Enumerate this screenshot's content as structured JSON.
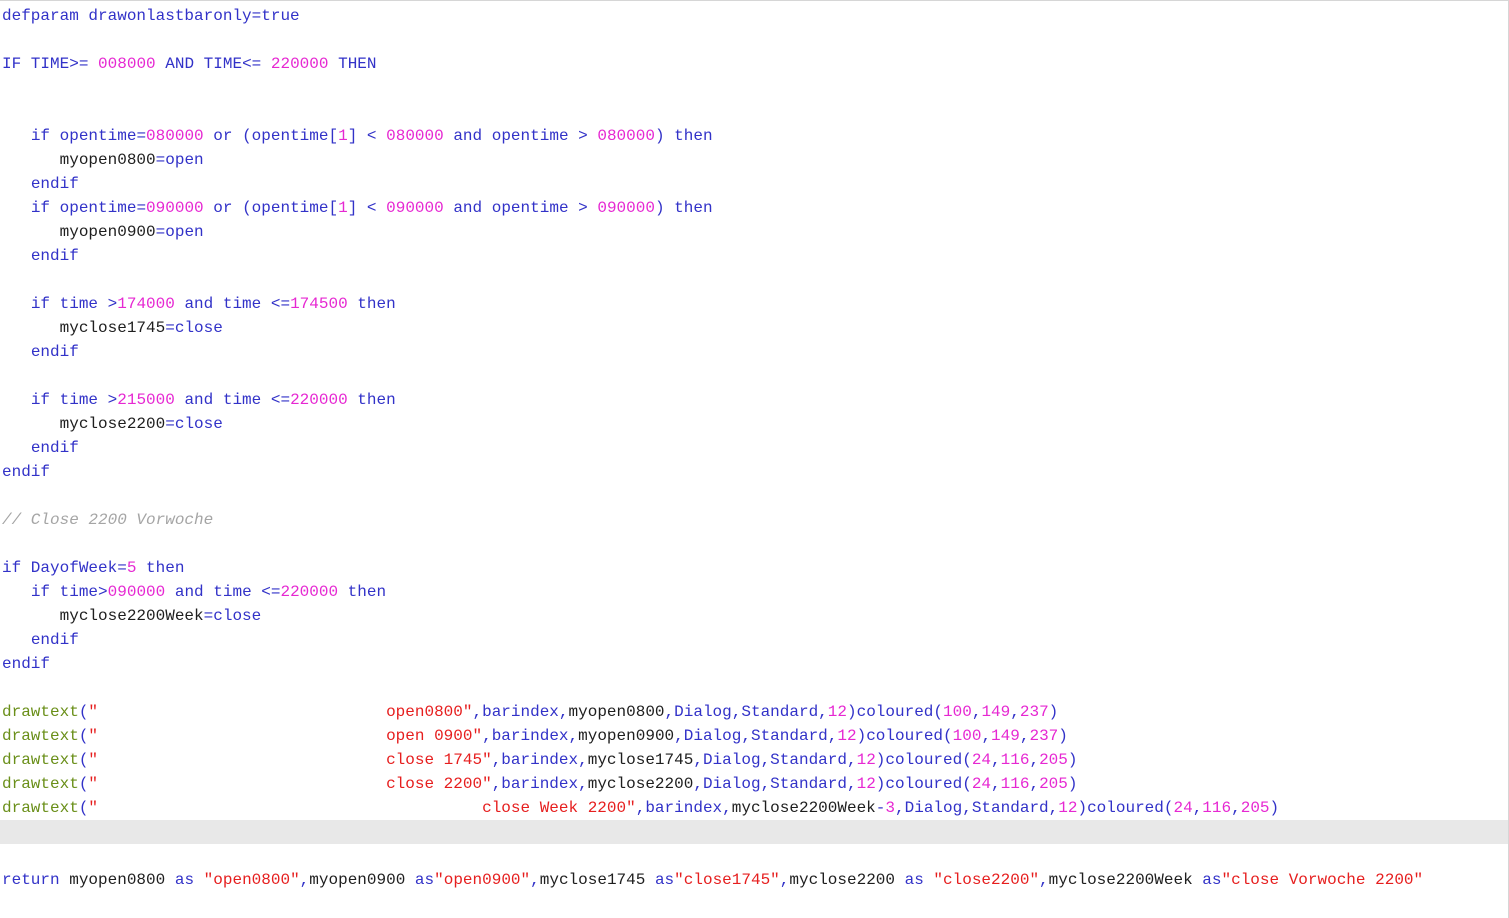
{
  "colors": {
    "keyword": "#3232c8",
    "number": "#e628d2",
    "string": "#e61e1e",
    "function": "#6a8f19",
    "comment": "#a5a5a5",
    "identifier": "#1e1e1e",
    "current_line": "#e8e8e8"
  },
  "editor": {
    "lines": [
      {
        "line": 1,
        "tokens": [
          [
            "kw",
            "defparam drawonlastbaronly"
          ],
          [
            "op",
            "="
          ],
          [
            "kw",
            "true"
          ]
        ]
      },
      {
        "line": 3,
        "tokens": [
          [
            "kw",
            "IF TIME"
          ],
          [
            "op",
            ">= "
          ],
          [
            "num",
            "008000"
          ],
          [
            "kw",
            " AND TIME"
          ],
          [
            "op",
            "<= "
          ],
          [
            "num",
            "220000"
          ],
          [
            "kw",
            " THEN"
          ]
        ]
      },
      {
        "line": 6,
        "tokens": [
          [
            "id",
            "   "
          ],
          [
            "kw",
            "if opentime"
          ],
          [
            "op",
            "="
          ],
          [
            "num",
            "080000"
          ],
          [
            "kw",
            " or "
          ],
          [
            "op",
            "("
          ],
          [
            "kw",
            "opentime"
          ],
          [
            "op",
            "["
          ],
          [
            "num",
            "1"
          ],
          [
            "op",
            "] < "
          ],
          [
            "num",
            "080000"
          ],
          [
            "kw",
            " and opentime "
          ],
          [
            "op",
            "> "
          ],
          [
            "num",
            "080000"
          ],
          [
            "op",
            ")"
          ],
          [
            "kw",
            " then"
          ]
        ]
      },
      {
        "line": 7,
        "tokens": [
          [
            "id",
            "      myopen0800"
          ],
          [
            "op",
            "="
          ],
          [
            "kw",
            "open"
          ]
        ]
      },
      {
        "line": 8,
        "tokens": [
          [
            "id",
            "   "
          ],
          [
            "kw",
            "endif"
          ]
        ]
      },
      {
        "line": 9,
        "tokens": [
          [
            "id",
            "   "
          ],
          [
            "kw",
            "if opentime"
          ],
          [
            "op",
            "="
          ],
          [
            "num",
            "090000"
          ],
          [
            "kw",
            " or "
          ],
          [
            "op",
            "("
          ],
          [
            "kw",
            "opentime"
          ],
          [
            "op",
            "["
          ],
          [
            "num",
            "1"
          ],
          [
            "op",
            "] < "
          ],
          [
            "num",
            "090000"
          ],
          [
            "kw",
            " and opentime "
          ],
          [
            "op",
            "> "
          ],
          [
            "num",
            "090000"
          ],
          [
            "op",
            ")"
          ],
          [
            "kw",
            " then"
          ]
        ]
      },
      {
        "line": 10,
        "tokens": [
          [
            "id",
            "      myopen0900"
          ],
          [
            "op",
            "="
          ],
          [
            "kw",
            "open"
          ]
        ]
      },
      {
        "line": 11,
        "tokens": [
          [
            "id",
            "   "
          ],
          [
            "kw",
            "endif"
          ]
        ]
      },
      {
        "line": 13,
        "tokens": [
          [
            "id",
            "   "
          ],
          [
            "kw",
            "if time "
          ],
          [
            "op",
            ">"
          ],
          [
            "num",
            "174000"
          ],
          [
            "kw",
            " and time "
          ],
          [
            "op",
            "<="
          ],
          [
            "num",
            "174500"
          ],
          [
            "kw",
            " then"
          ]
        ]
      },
      {
        "line": 14,
        "tokens": [
          [
            "id",
            "      myclose1745"
          ],
          [
            "op",
            "="
          ],
          [
            "kw",
            "close"
          ]
        ]
      },
      {
        "line": 15,
        "tokens": [
          [
            "id",
            "   "
          ],
          [
            "kw",
            "endif"
          ]
        ]
      },
      {
        "line": 17,
        "tokens": [
          [
            "id",
            "   "
          ],
          [
            "kw",
            "if time "
          ],
          [
            "op",
            ">"
          ],
          [
            "num",
            "215000"
          ],
          [
            "kw",
            " and time "
          ],
          [
            "op",
            "<="
          ],
          [
            "num",
            "220000"
          ],
          [
            "kw",
            " then"
          ]
        ]
      },
      {
        "line": 18,
        "tokens": [
          [
            "id",
            "      myclose2200"
          ],
          [
            "op",
            "="
          ],
          [
            "kw",
            "close"
          ]
        ]
      },
      {
        "line": 19,
        "tokens": [
          [
            "id",
            "   "
          ],
          [
            "kw",
            "endif"
          ]
        ]
      },
      {
        "line": 20,
        "tokens": [
          [
            "kw",
            "endif"
          ]
        ]
      },
      {
        "line": 22,
        "tokens": [
          [
            "cm",
            "// Close 2200 Vorwoche"
          ]
        ]
      },
      {
        "line": 24,
        "tokens": [
          [
            "kw",
            "if DayofWeek"
          ],
          [
            "op",
            "="
          ],
          [
            "num",
            "5"
          ],
          [
            "kw",
            " then"
          ]
        ]
      },
      {
        "line": 25,
        "tokens": [
          [
            "id",
            "   "
          ],
          [
            "kw",
            "if time"
          ],
          [
            "op",
            ">"
          ],
          [
            "num",
            "090000"
          ],
          [
            "kw",
            " and time "
          ],
          [
            "op",
            "<="
          ],
          [
            "num",
            "220000"
          ],
          [
            "kw",
            " then"
          ]
        ]
      },
      {
        "line": 26,
        "tokens": [
          [
            "id",
            "      myclose2200Week"
          ],
          [
            "op",
            "="
          ],
          [
            "kw",
            "close"
          ]
        ]
      },
      {
        "line": 27,
        "tokens": [
          [
            "id",
            "   "
          ],
          [
            "kw",
            "endif"
          ]
        ]
      },
      {
        "line": 28,
        "tokens": [
          [
            "kw",
            "endif"
          ]
        ]
      },
      {
        "line": 30,
        "tokens": [
          [
            "fn",
            "drawtext"
          ],
          [
            "op",
            "("
          ],
          [
            "str",
            "\"                              open0800\""
          ],
          [
            "op",
            ","
          ],
          [
            "kw",
            "barindex"
          ],
          [
            "op",
            ","
          ],
          [
            "id",
            "myopen0800"
          ],
          [
            "op",
            ","
          ],
          [
            "kw",
            "Dialog"
          ],
          [
            "op",
            ","
          ],
          [
            "kw",
            "Standard"
          ],
          [
            "op",
            ","
          ],
          [
            "num",
            "12"
          ],
          [
            "op",
            ")"
          ],
          [
            "kw",
            "coloured"
          ],
          [
            "op",
            "("
          ],
          [
            "num",
            "100"
          ],
          [
            "op",
            ","
          ],
          [
            "num",
            "149"
          ],
          [
            "op",
            ","
          ],
          [
            "num",
            "237"
          ],
          [
            "op",
            ")"
          ]
        ]
      },
      {
        "line": 31,
        "tokens": [
          [
            "fn",
            "drawtext"
          ],
          [
            "op",
            "("
          ],
          [
            "str",
            "\"                              open 0900\""
          ],
          [
            "op",
            ","
          ],
          [
            "kw",
            "barindex"
          ],
          [
            "op",
            ","
          ],
          [
            "id",
            "myopen0900"
          ],
          [
            "op",
            ","
          ],
          [
            "kw",
            "Dialog"
          ],
          [
            "op",
            ","
          ],
          [
            "kw",
            "Standard"
          ],
          [
            "op",
            ","
          ],
          [
            "num",
            "12"
          ],
          [
            "op",
            ")"
          ],
          [
            "kw",
            "coloured"
          ],
          [
            "op",
            "("
          ],
          [
            "num",
            "100"
          ],
          [
            "op",
            ","
          ],
          [
            "num",
            "149"
          ],
          [
            "op",
            ","
          ],
          [
            "num",
            "237"
          ],
          [
            "op",
            ")"
          ]
        ]
      },
      {
        "line": 32,
        "tokens": [
          [
            "fn",
            "drawtext"
          ],
          [
            "op",
            "("
          ],
          [
            "str",
            "\"                              close 1745\""
          ],
          [
            "op",
            ","
          ],
          [
            "kw",
            "barindex"
          ],
          [
            "op",
            ","
          ],
          [
            "id",
            "myclose1745"
          ],
          [
            "op",
            ","
          ],
          [
            "kw",
            "Dialog"
          ],
          [
            "op",
            ","
          ],
          [
            "kw",
            "Standard"
          ],
          [
            "op",
            ","
          ],
          [
            "num",
            "12"
          ],
          [
            "op",
            ")"
          ],
          [
            "kw",
            "coloured"
          ],
          [
            "op",
            "("
          ],
          [
            "num",
            "24"
          ],
          [
            "op",
            ","
          ],
          [
            "num",
            "116"
          ],
          [
            "op",
            ","
          ],
          [
            "num",
            "205"
          ],
          [
            "op",
            ")"
          ]
        ]
      },
      {
        "line": 33,
        "tokens": [
          [
            "fn",
            "drawtext"
          ],
          [
            "op",
            "("
          ],
          [
            "str",
            "\"                              close 2200\""
          ],
          [
            "op",
            ","
          ],
          [
            "kw",
            "barindex"
          ],
          [
            "op",
            ","
          ],
          [
            "id",
            "myclose2200"
          ],
          [
            "op",
            ","
          ],
          [
            "kw",
            "Dialog"
          ],
          [
            "op",
            ","
          ],
          [
            "kw",
            "Standard"
          ],
          [
            "op",
            ","
          ],
          [
            "num",
            "12"
          ],
          [
            "op",
            ")"
          ],
          [
            "kw",
            "coloured"
          ],
          [
            "op",
            "("
          ],
          [
            "num",
            "24"
          ],
          [
            "op",
            ","
          ],
          [
            "num",
            "116"
          ],
          [
            "op",
            ","
          ],
          [
            "num",
            "205"
          ],
          [
            "op",
            ")"
          ]
        ]
      },
      {
        "line": 34,
        "tokens": [
          [
            "fn",
            "drawtext"
          ],
          [
            "op",
            "("
          ],
          [
            "str",
            "\"                                        close Week 2200\""
          ],
          [
            "op",
            ","
          ],
          [
            "kw",
            "barindex"
          ],
          [
            "op",
            ","
          ],
          [
            "id",
            "myclose2200Week"
          ],
          [
            "op",
            "-"
          ],
          [
            "num",
            "3"
          ],
          [
            "op",
            ","
          ],
          [
            "kw",
            "Dialog"
          ],
          [
            "op",
            ","
          ],
          [
            "kw",
            "Standard"
          ],
          [
            "op",
            ","
          ],
          [
            "num",
            "12"
          ],
          [
            "op",
            ")"
          ],
          [
            "kw",
            "coloured"
          ],
          [
            "op",
            "("
          ],
          [
            "num",
            "24"
          ],
          [
            "op",
            ","
          ],
          [
            "num",
            "116"
          ],
          [
            "op",
            ","
          ],
          [
            "num",
            "205"
          ],
          [
            "op",
            ")"
          ]
        ]
      },
      {
        "line": 35,
        "current": true,
        "tokens": []
      },
      {
        "line": 37,
        "tokens": [
          [
            "kw",
            "return "
          ],
          [
            "id",
            "myopen0800 "
          ],
          [
            "kw",
            "as "
          ],
          [
            "str",
            "\"open0800\""
          ],
          [
            "op",
            ","
          ],
          [
            "id",
            "myopen0900 "
          ],
          [
            "kw",
            "as"
          ],
          [
            "str",
            "\"open0900\""
          ],
          [
            "op",
            ","
          ],
          [
            "id",
            "myclose1745 "
          ],
          [
            "kw",
            "as"
          ],
          [
            "str",
            "\"close1745\""
          ],
          [
            "op",
            ","
          ],
          [
            "id",
            "myclose2200 "
          ],
          [
            "kw",
            "as "
          ],
          [
            "str",
            "\"close2200\""
          ],
          [
            "op",
            ","
          ],
          [
            "id",
            "myclose2200Week "
          ],
          [
            "kw",
            "as"
          ],
          [
            "str",
            "\"close Vorwoche 2200\""
          ]
        ]
      }
    ]
  }
}
